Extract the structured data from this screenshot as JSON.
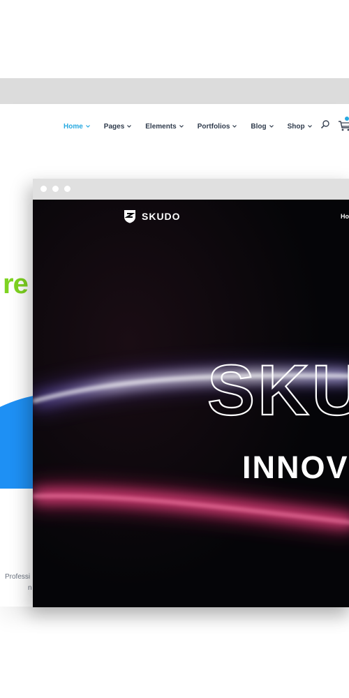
{
  "back_window": {
    "nav": {
      "items": [
        {
          "label": "Home",
          "active": true
        },
        {
          "label": "Pages",
          "active": false
        },
        {
          "label": "Elements",
          "active": false
        },
        {
          "label": "Portfolios",
          "active": false
        },
        {
          "label": "Blog",
          "active": false
        },
        {
          "label": "Shop",
          "active": false
        }
      ]
    },
    "hero_fragment": "re",
    "text_fragment_1": "Professi",
    "text_fragment_2": "n"
  },
  "front_window": {
    "brand": "SKUDO",
    "nav_fragment": "Ho",
    "hero_title": "SKUDO",
    "hero_subtitle": "INNOV"
  },
  "colors": {
    "accent_blue": "#27a9e1",
    "green_text": "#7ed321",
    "blue_shape": "#1e90f4",
    "dark_bg": "#050508"
  }
}
